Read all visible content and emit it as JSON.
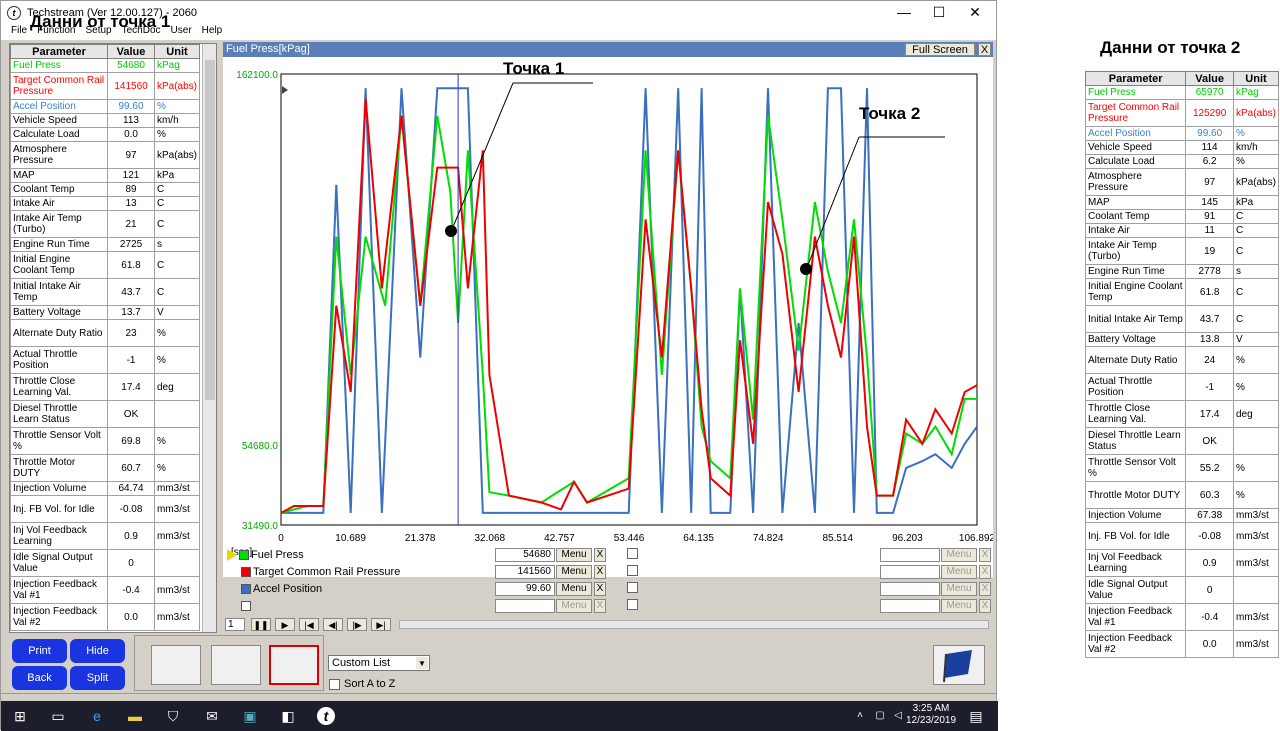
{
  "window": {
    "title": "Techstream (Ver 12.00.127) - 2060",
    "menu": [
      "File",
      "Function",
      "Setup",
      "TechDoc",
      "User",
      "Help"
    ],
    "controls": [
      "—",
      "☐",
      "✕"
    ]
  },
  "annotations": {
    "point1_label": "Данни от точка 1",
    "point2_label": "Данни от точка 2",
    "marker1": "Точка 1",
    "marker2": "Точка 2"
  },
  "table_headers": {
    "param": "Parameter",
    "value": "Value",
    "unit": "Unit"
  },
  "left_table": [
    {
      "name": "Fuel Press",
      "value": "54680",
      "unit": "kPag",
      "color": "#00cc00"
    },
    {
      "name": "Target Common Rail Pressure",
      "value": "141560",
      "unit": "kPa(abs)",
      "color": "#ff0000"
    },
    {
      "name": "Accel Position",
      "value": "99.60",
      "unit": "%",
      "color": "#3a7fcf"
    },
    {
      "name": "Vehicle Speed",
      "value": "113",
      "unit": "km/h"
    },
    {
      "name": "Calculate Load",
      "value": "0.0",
      "unit": "%"
    },
    {
      "name": "Atmosphere Pressure",
      "value": "97",
      "unit": "kPa(abs)"
    },
    {
      "name": "MAP",
      "value": "121",
      "unit": "kPa"
    },
    {
      "name": "Coolant Temp",
      "value": "89",
      "unit": "C"
    },
    {
      "name": "Intake Air",
      "value": "13",
      "unit": "C"
    },
    {
      "name": "Intake Air Temp (Turbo)",
      "value": "21",
      "unit": "C"
    },
    {
      "name": "Engine Run Time",
      "value": "2725",
      "unit": "s"
    },
    {
      "name": "Initial Engine Coolant Temp",
      "value": "61.8",
      "unit": "C"
    },
    {
      "name": "Initial Intake Air Temp",
      "value": "43.7",
      "unit": "C"
    },
    {
      "name": "Battery Voltage",
      "value": "13.7",
      "unit": "V"
    },
    {
      "name": "Alternate Duty Ratio",
      "value": "23",
      "unit": "%"
    },
    {
      "name": "Actual Throttle Position",
      "value": "-1",
      "unit": "%"
    },
    {
      "name": "Throttle Close Learning Val.",
      "value": "17.4",
      "unit": "deg"
    },
    {
      "name": "Diesel Throttle Learn Status",
      "value": "OK",
      "unit": ""
    },
    {
      "name": "Throttle Sensor Volt %",
      "value": "69.8",
      "unit": "%"
    },
    {
      "name": "Throttle Motor DUTY",
      "value": "60.7",
      "unit": "%"
    },
    {
      "name": "Injection Volume",
      "value": "64.74",
      "unit": "mm3/st"
    },
    {
      "name": "Inj. FB Vol. for Idle",
      "value": "-0.08",
      "unit": "mm3/st"
    },
    {
      "name": "Inj Vol Feedback Learning",
      "value": "0.9",
      "unit": "mm3/st"
    },
    {
      "name": "Idle Signal Output Value",
      "value": "0",
      "unit": ""
    },
    {
      "name": "Injection Feedback Val #1",
      "value": "-0.4",
      "unit": "mm3/st"
    },
    {
      "name": "Injection Feedback Val #2",
      "value": "0.0",
      "unit": "mm3/st"
    }
  ],
  "right_table": [
    {
      "name": "Fuel Press",
      "value": "65970",
      "unit": "kPag",
      "color": "#00cc00"
    },
    {
      "name": "Target Common Rail Pressure",
      "value": "125290",
      "unit": "kPa(abs)",
      "color": "#ff0000"
    },
    {
      "name": "Accel Position",
      "value": "99.60",
      "unit": "%",
      "color": "#3a7fcf"
    },
    {
      "name": "Vehicle Speed",
      "value": "114",
      "unit": "km/h"
    },
    {
      "name": "Calculate Load",
      "value": "6.2",
      "unit": "%"
    },
    {
      "name": "Atmosphere Pressure",
      "value": "97",
      "unit": "kPa(abs)"
    },
    {
      "name": "MAP",
      "value": "145",
      "unit": "kPa"
    },
    {
      "name": "Coolant Temp",
      "value": "91",
      "unit": "C"
    },
    {
      "name": "Intake Air",
      "value": "11",
      "unit": "C"
    },
    {
      "name": "Intake Air Temp (Turbo)",
      "value": "19",
      "unit": "C"
    },
    {
      "name": "Engine Run Time",
      "value": "2778",
      "unit": "s"
    },
    {
      "name": "Initial Engine Coolant Temp",
      "value": "61.8",
      "unit": "C"
    },
    {
      "name": "Initial Intake Air Temp",
      "value": "43.7",
      "unit": "C"
    },
    {
      "name": "Battery Voltage",
      "value": "13.8",
      "unit": "V"
    },
    {
      "name": "Alternate Duty Ratio",
      "value": "24",
      "unit": "%"
    },
    {
      "name": "Actual Throttle Position",
      "value": "-1",
      "unit": "%"
    },
    {
      "name": "Throttle Close Learning Val.",
      "value": "17.4",
      "unit": "deg"
    },
    {
      "name": "Diesel Throttle Learn Status",
      "value": "OK",
      "unit": ""
    },
    {
      "name": "Throttle Sensor Volt %",
      "value": "55.2",
      "unit": "%"
    },
    {
      "name": "Throttle Motor DUTY",
      "value": "60.3",
      "unit": "%"
    },
    {
      "name": "Injection Volume",
      "value": "67.38",
      "unit": "mm3/st"
    },
    {
      "name": "Inj. FB Vol. for Idle",
      "value": "-0.08",
      "unit": "mm3/st"
    },
    {
      "name": "Inj Vol Feedback Learning",
      "value": "0.9",
      "unit": "mm3/st"
    },
    {
      "name": "Idle Signal Output Value",
      "value": "0",
      "unit": ""
    },
    {
      "name": "Injection Feedback Val #1",
      "value": "-0.4",
      "unit": "mm3/st"
    },
    {
      "name": "Injection Feedback Val #2",
      "value": "0.0",
      "unit": "mm3/st"
    }
  ],
  "graph": {
    "header": "Fuel Press[kPag]",
    "full_screen": "Full Screen",
    "close": "X",
    "x_unit": "[sec]",
    "menu_label": "Menu",
    "x_label": "X",
    "page": "1",
    "legend": [
      {
        "name": "Fuel Press",
        "value": "54680",
        "color": "#00dd00"
      },
      {
        "name": "Target Common Rail Pressure",
        "value": "141560",
        "color": "#ee0000"
      },
      {
        "name": "Accel Position",
        "value": "99.60",
        "color": "#3a70c0"
      }
    ]
  },
  "chart_data": {
    "type": "line",
    "ylim": [
      31490.0,
      162100.0
    ],
    "y_ticks": [
      "162100.0",
      "54680.0",
      "31490.0"
    ],
    "xlim": [
      0,
      106.892
    ],
    "x_ticks": [
      "0",
      "10.689",
      "21.378",
      "32.068",
      "42.757",
      "53.446",
      "64.135",
      "74.824",
      "85.514",
      "96.203",
      "106.892"
    ],
    "cursor_x": 27.2,
    "series": [
      {
        "name": "Fuel Press",
        "color": "#00dd00",
        "x": [
          0,
          4,
          6.5,
          8.5,
          10.7,
          13,
          16,
          18.5,
          21.4,
          24,
          26,
          27.2,
          28.7,
          31,
          32,
          35,
          40,
          45,
          47,
          53.4,
          56,
          58.5,
          61,
          63,
          64.6,
          66,
          69,
          70.5,
          72.5,
          74.8,
          77,
          79.5,
          82,
          84,
          86,
          88,
          90,
          91.5,
          94,
          96,
          98.5,
          100.5,
          103,
          105,
          106.9
        ],
        "y": [
          35000,
          37000,
          37000,
          115000,
          75000,
          115000,
          95000,
          150000,
          95000,
          150000,
          128000,
          90000,
          140000,
          75000,
          41000,
          40000,
          38000,
          44000,
          38000,
          45000,
          140000,
          75000,
          140000,
          100000,
          60000,
          50000,
          45000,
          100000,
          62000,
          150000,
          120000,
          82000,
          125000,
          105000,
          90000,
          120000,
          80000,
          40000,
          40000,
          58000,
          55000,
          60000,
          52000,
          68000,
          68000
        ]
      },
      {
        "name": "Target Common Rail Pressure",
        "color": "#ee0000",
        "x": [
          0,
          2,
          6.5,
          8.5,
          10.7,
          13,
          15.5,
          18.5,
          21.4,
          24,
          27.2,
          28.7,
          31,
          32,
          35,
          40,
          43,
          45,
          47,
          53.4,
          56,
          58.5,
          61,
          63,
          64.6,
          66,
          69,
          70.5,
          72.5,
          74.8,
          77,
          79.5,
          82,
          84,
          86,
          88,
          90,
          91.5,
          94,
          96,
          98.5,
          100.5,
          103,
          105,
          106.9
        ],
        "y": [
          35000,
          37000,
          37000,
          95000,
          70000,
          155000,
          100000,
          150000,
          95000,
          135000,
          135000,
          100000,
          140000,
          75000,
          40000,
          38000,
          36000,
          44000,
          38000,
          42000,
          120000,
          80000,
          140000,
          100000,
          65000,
          45000,
          40000,
          85000,
          55000,
          125000,
          110000,
          70000,
          115000,
          95000,
          80000,
          115000,
          60000,
          40000,
          40000,
          62000,
          55000,
          65000,
          58000,
          70000,
          72000
        ]
      },
      {
        "name": "Accel Position",
        "color": "#3a70c0",
        "x": [
          0,
          6.5,
          8.5,
          10.7,
          13,
          15.5,
          18.5,
          21.4,
          24,
          27.2,
          28.7,
          31,
          32,
          53.4,
          56,
          58.5,
          61,
          63,
          64.6,
          66,
          69,
          70.5,
          72.5,
          74.8,
          77,
          79.5,
          82,
          84,
          86,
          88,
          90,
          91.5,
          94,
          96,
          98.5,
          100.5,
          103,
          105,
          106.9
        ],
        "y": [
          35000,
          35000,
          130000,
          35000,
          158000,
          35000,
          158000,
          80000,
          158000,
          158000,
          158000,
          35000,
          35000,
          35000,
          158000,
          35000,
          158000,
          35000,
          158000,
          35000,
          35000,
          100000,
          35000,
          158000,
          35000,
          90000,
          35000,
          158000,
          158000,
          35000,
          158000,
          35000,
          35000,
          48000,
          50000,
          52000,
          48000,
          55000,
          60000
        ]
      }
    ]
  },
  "bottom": {
    "buttons": {
      "print": "Print",
      "hide": "Hide",
      "back": "Back",
      "split": "Split"
    },
    "custom_list": "Custom List",
    "sort": "Sort A to Z"
  },
  "taskbar": {
    "time": "3:25 AM",
    "date": "12/23/2019"
  }
}
